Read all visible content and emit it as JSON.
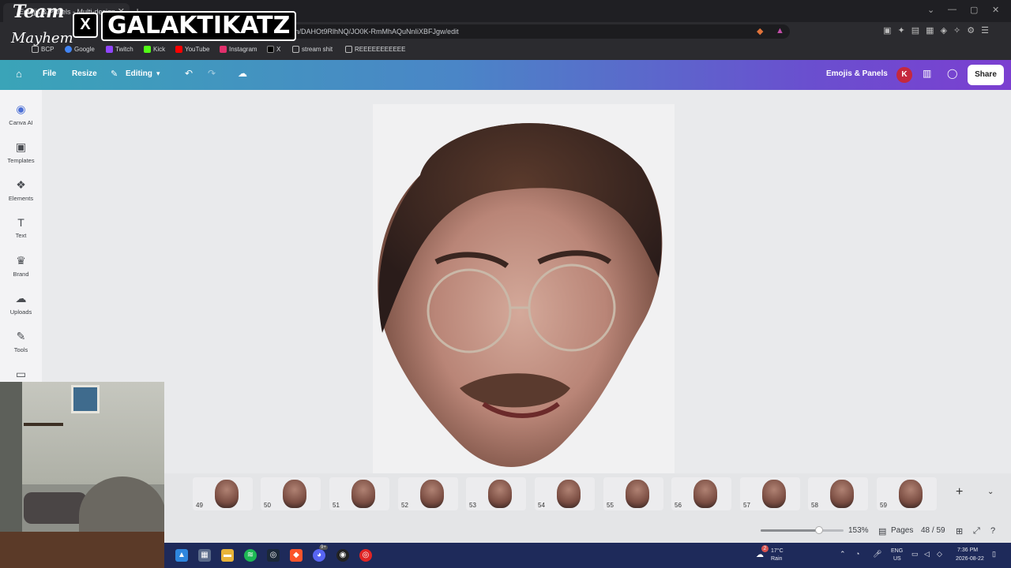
{
  "browser": {
    "tab_title": "Emojis & Panels - Multi-design",
    "url": "design/DAHOt9RlhNQ/JO0K-RmMhAQuNnIiXBFJgw/edit",
    "bookmarks": [
      "BCP",
      "Google",
      "Twitch",
      "Kick",
      "YouTube",
      "Instagram",
      "X",
      "stream shit",
      "REEEEEEEEEEE"
    ]
  },
  "overlay": {
    "team": "Team",
    "mayhem": "Mayhem",
    "x_letter": "X",
    "handle": "GALAKTIKATZ"
  },
  "header": {
    "file": "File",
    "resize": "Resize",
    "editing": "Editing",
    "design_title": "Emojis & Panels",
    "avatar_letter": "K",
    "share": "Share"
  },
  "sidebar": {
    "items": [
      {
        "label": "Canva AI",
        "icon": "canva-ai-icon"
      },
      {
        "label": "Templates",
        "icon": "templates-icon"
      },
      {
        "label": "Elements",
        "icon": "elements-icon"
      },
      {
        "label": "Text",
        "icon": "text-icon"
      },
      {
        "label": "Brand",
        "icon": "brand-icon"
      },
      {
        "label": "Uploads",
        "icon": "uploads-icon"
      },
      {
        "label": "Tools",
        "icon": "tools-icon"
      }
    ]
  },
  "pages": {
    "thumbnails": [
      "49",
      "50",
      "51",
      "52",
      "53",
      "54",
      "55",
      "56",
      "57",
      "58",
      "59"
    ]
  },
  "footer": {
    "zoom": "153%",
    "zoom_fraction": 0.7,
    "pages_label": "Pages",
    "page_counter": "48 / 59"
  },
  "taskbar": {
    "weather_badge": "2",
    "temp": "17°C",
    "weather": "Rain",
    "lang": "ENG",
    "region": "US",
    "time": "7:36 PM",
    "date": "2026-08-22",
    "discord_badge": "9+"
  },
  "colors": {
    "header_start": "#3aa4b8",
    "header_end": "#7b3fd0",
    "avatar": "#c5283d",
    "taskbar": "#1e2a5a"
  }
}
